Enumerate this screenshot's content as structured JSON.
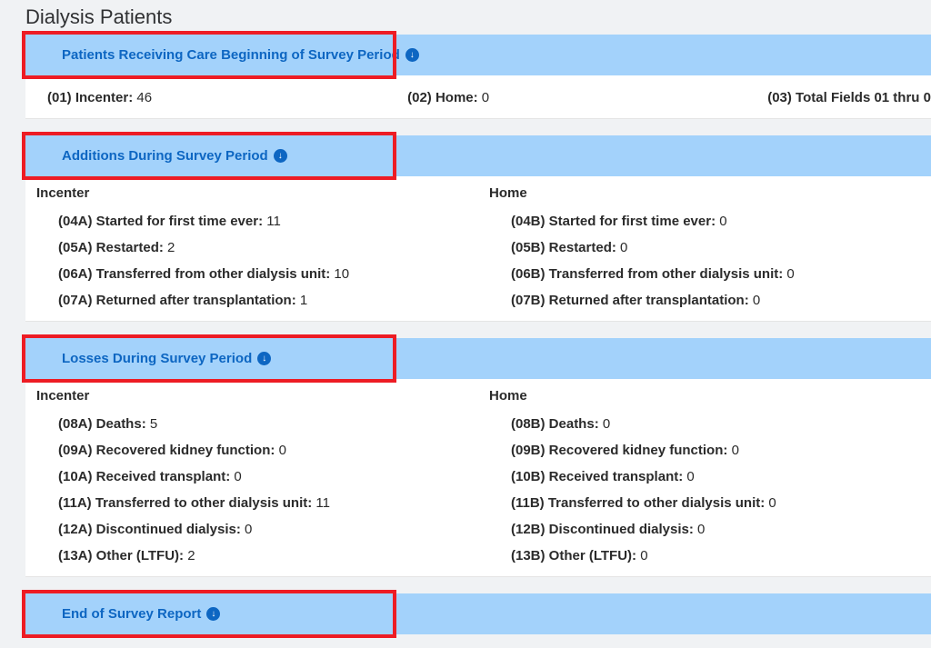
{
  "title": "Dialysis Patients",
  "sections": {
    "receiving": {
      "header": "Patients Receiving Care Beginning of Survey Period",
      "f01_label": "(01) Incenter:",
      "f01_val": "46",
      "f02_label": "(02) Home:",
      "f02_val": "0",
      "f03_label": "(03) Total Fields 01 thru 0"
    },
    "additions": {
      "header": "Additions During Survey Period",
      "incenter_label": "Incenter",
      "home_label": "Home",
      "rows": [
        {
          "a_label": "(04A) Started for first time ever:",
          "a_val": "11",
          "b_label": "(04B) Started for first time ever:",
          "b_val": "0"
        },
        {
          "a_label": "(05A) Restarted:",
          "a_val": "2",
          "b_label": "(05B) Restarted:",
          "b_val": "0"
        },
        {
          "a_label": "(06A) Transferred from other dialysis unit:",
          "a_val": "10",
          "b_label": "(06B) Transferred from other dialysis unit:",
          "b_val": "0"
        },
        {
          "a_label": "(07A) Returned after transplantation:",
          "a_val": "1",
          "b_label": "(07B) Returned after transplantation:",
          "b_val": "0"
        }
      ]
    },
    "losses": {
      "header": "Losses During Survey Period",
      "incenter_label": "Incenter",
      "home_label": "Home",
      "rows": [
        {
          "a_label": "(08A) Deaths:",
          "a_val": "5",
          "b_label": "(08B) Deaths:",
          "b_val": "0"
        },
        {
          "a_label": "(09A) Recovered kidney function:",
          "a_val": "0",
          "b_label": "(09B) Recovered kidney function:",
          "b_val": "0"
        },
        {
          "a_label": "(10A) Received transplant:",
          "a_val": "0",
          "b_label": "(10B) Received transplant:",
          "b_val": "0"
        },
        {
          "a_label": "(11A) Transferred to other dialysis unit:",
          "a_val": "11",
          "b_label": "(11B) Transferred to other dialysis unit:",
          "b_val": "0"
        },
        {
          "a_label": "(12A) Discontinued dialysis:",
          "a_val": "0",
          "b_label": "(12B) Discontinued dialysis:",
          "b_val": "0"
        },
        {
          "a_label": "(13A) Other (LTFU):",
          "a_val": "2",
          "b_label": "(13B) Other (LTFU):",
          "b_val": "0"
        }
      ]
    },
    "end": {
      "header": "End of Survey Report"
    }
  }
}
